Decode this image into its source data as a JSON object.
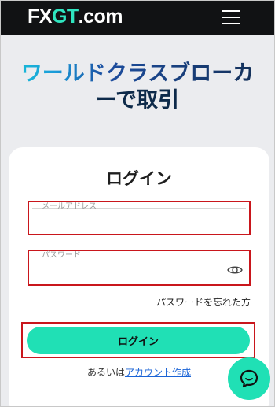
{
  "header": {
    "logo": {
      "part1": "FX",
      "part2": "GT",
      "part3": ".com"
    },
    "menu_icon": "hamburger-icon"
  },
  "hero": {
    "line1_part1": "ワールド",
    "line1_part2": "クラスブローカ",
    "line2": "ーで取引"
  },
  "login": {
    "title": "ログイン",
    "email_label": "メールアドレス",
    "email_value": "",
    "password_label": "パスワード",
    "password_value": "",
    "show_password_icon": "eye-icon",
    "forgot_label": "パスワードを忘れた方",
    "submit_label": "ログイン",
    "signup_prefix": "あるいは",
    "signup_link": "アカウント作成"
  },
  "chat": {
    "icon": "chat-bubble-icon"
  },
  "colors": {
    "header_bg": "#111214",
    "accent": "#20e0b5",
    "highlight_border": "#c9161c",
    "link": "#1a63d6"
  }
}
